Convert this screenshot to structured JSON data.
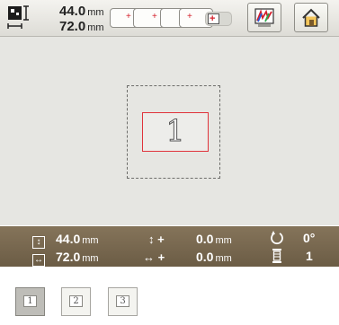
{
  "pattern_size": {
    "height_value": "44.0",
    "height_unit": "mm",
    "width_value": "72.0",
    "width_unit": "mm"
  },
  "hoop_options": [
    {
      "icon": "hoop-small-icon",
      "state": "available"
    },
    {
      "icon": "hoop-medium-icon",
      "state": "available"
    },
    {
      "icon": "hoop-large-icon",
      "state": "available"
    },
    {
      "icon": "hoop-xl-icon",
      "state": "selected"
    }
  ],
  "toolbar": {
    "thread_color_icon": "thread-color-icon",
    "home_icon": "home-icon"
  },
  "pattern": {
    "character": "1",
    "frame_color": "#e0333b"
  },
  "status": {
    "height_value": "44.0",
    "height_unit": "mm",
    "width_value": "72.0",
    "width_unit": "mm",
    "offset_v_symbol": "↕ +",
    "offset_v_value": "0.0",
    "offset_v_unit": "mm",
    "offset_h_symbol": "↔ +",
    "offset_h_value": "0.0",
    "offset_h_unit": "mm",
    "rotation_value": "0°",
    "thread_count_value": "1"
  },
  "thumbnails": [
    {
      "label": "1",
      "selected": true
    },
    {
      "label": "2",
      "selected": false
    },
    {
      "label": "3",
      "selected": false
    }
  ],
  "colors": {
    "status_bar": "#7a6a50",
    "canvas": "#e6e6e2",
    "accent_red": "#d4212c"
  }
}
